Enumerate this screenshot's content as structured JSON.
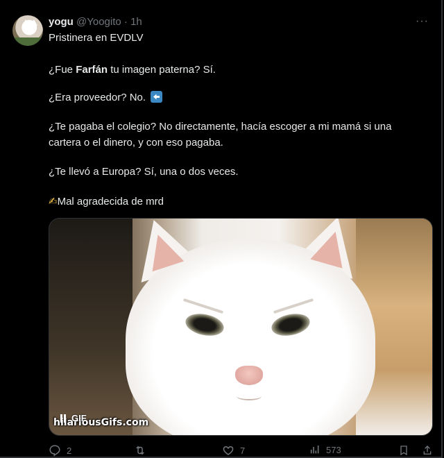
{
  "tweet": {
    "name": "yogu",
    "handle": "@Yoogito",
    "separator": "·",
    "time": "1h",
    "more_icon": "···",
    "lines": {
      "l1": "Pristinera en EVDLV",
      "l2_pre": "¿Fue ",
      "l2_bold": "Farfán",
      "l2_post": " tu imagen paterna? Sí.",
      "l3": "¿Era proveedor? No.",
      "l4a": "¿Te pagaba el colegio? No directamente, hacía escoger a mi mamá si una",
      "l4b": "cartera o el dinero, y con eso pagaba.",
      "l5": "¿Te llevó a Europa? Sí, una o dos veces.",
      "l6_emoji": "✍",
      "l6": "Mal agradecida de mrd"
    },
    "media": {
      "gif_label": "GIF",
      "watermark": "hilariousGifs.com"
    },
    "actions": {
      "replies": "2",
      "retweets": "",
      "likes": "7",
      "views": "573"
    }
  },
  "colors": {
    "background": "#000000",
    "text": "#e7e9ea",
    "muted": "#71767b",
    "arrow_emoji": "#3b88c3"
  },
  "icons": [
    "avatar",
    "more-icon",
    "left-arrow-emoji-icon",
    "writing-hand-emoji-icon",
    "pause-icon",
    "reply-icon",
    "retweet-icon",
    "like-icon",
    "views-icon",
    "bookmark-icon",
    "share-icon"
  ]
}
